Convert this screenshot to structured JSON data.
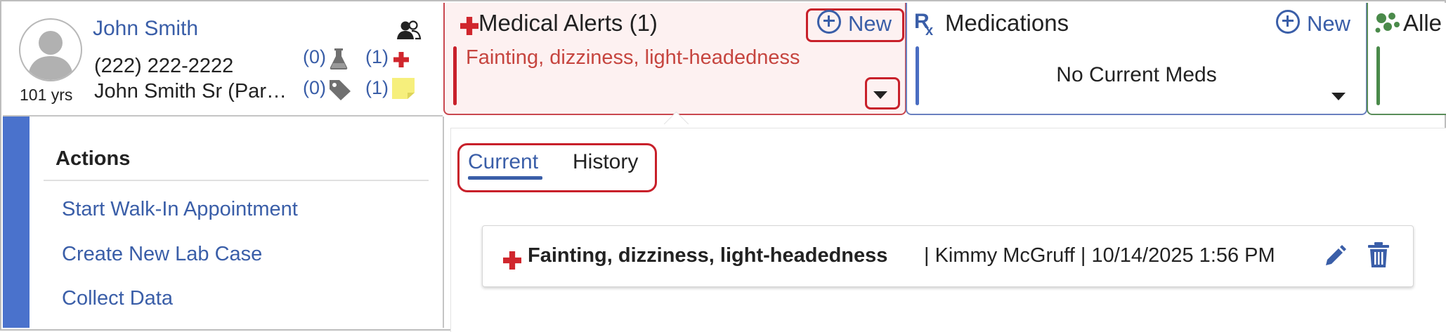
{
  "patient": {
    "name": "John Smith",
    "age": "101 yrs",
    "phone": "(222) 222-2222",
    "parent": "John Smith Sr (Parent)",
    "lab_count": "(0)",
    "alert_count": "(1)",
    "tag_count": "(0)",
    "note_count": "(1)"
  },
  "medical_alerts": {
    "title": "Medical Alerts (1)",
    "new_label": "New",
    "summary": "Fainting, dizziness, light-headedness"
  },
  "medications": {
    "title": "Medications",
    "new_label": "New",
    "empty_text": "No Current Meds"
  },
  "allergies": {
    "title": "Alle"
  },
  "actions": {
    "title": "Actions",
    "items": [
      "Start Walk-In Appointment",
      "Create New Lab Case",
      "Collect Data"
    ]
  },
  "alert_tabs": {
    "current": "Current",
    "history": "History"
  },
  "alert_row": {
    "name": "Fainting, dizziness, light-headedness",
    "meta": "| Kimmy McGruff | 10/14/2025 1:56 PM"
  },
  "colors": {
    "accent_blue": "#3a5ea8",
    "alert_red": "#c8202a",
    "alert_bg": "#fdf1f1",
    "strip_blue": "#4a72cc",
    "sticky_yellow": "#f6ef7c"
  },
  "icons": [
    "person-avatar-icon",
    "group-icon",
    "flask-icon",
    "red-cross-icon",
    "tag-icon",
    "sticky-note-icon",
    "plus-circle-icon",
    "rx-icon",
    "caret-down-icon",
    "allergy-icon",
    "pencil-icon",
    "trash-icon"
  ]
}
